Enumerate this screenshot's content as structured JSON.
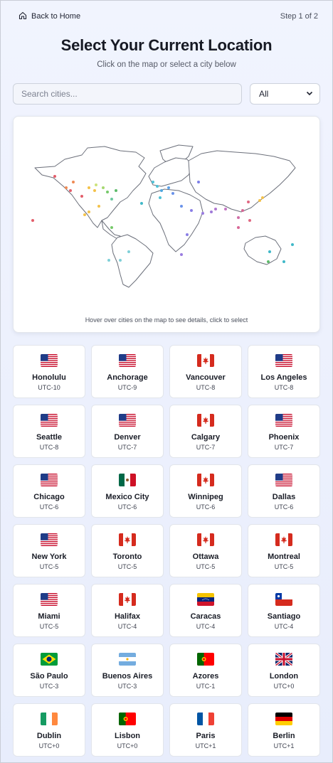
{
  "nav": {
    "back_label": "Back to Home",
    "step_label": "Step 1 of 2"
  },
  "header": {
    "title": "Select Your Current Location",
    "subtitle": "Click on the map or select a city below"
  },
  "search": {
    "placeholder": "Search cities...",
    "value": ""
  },
  "filter": {
    "selected": "All"
  },
  "map": {
    "hint": "Hover over cities on the map to see details, click to select"
  },
  "cities": [
    {
      "name": "Honolulu",
      "tz": "UTC-10",
      "flag": "us"
    },
    {
      "name": "Anchorage",
      "tz": "UTC-9",
      "flag": "us"
    },
    {
      "name": "Vancouver",
      "tz": "UTC-8",
      "flag": "ca"
    },
    {
      "name": "Los Angeles",
      "tz": "UTC-8",
      "flag": "us"
    },
    {
      "name": "Seattle",
      "tz": "UTC-8",
      "flag": "us"
    },
    {
      "name": "Denver",
      "tz": "UTC-7",
      "flag": "us"
    },
    {
      "name": "Calgary",
      "tz": "UTC-7",
      "flag": "ca"
    },
    {
      "name": "Phoenix",
      "tz": "UTC-7",
      "flag": "us"
    },
    {
      "name": "Chicago",
      "tz": "UTC-6",
      "flag": "us"
    },
    {
      "name": "Mexico City",
      "tz": "UTC-6",
      "flag": "mx"
    },
    {
      "name": "Winnipeg",
      "tz": "UTC-6",
      "flag": "ca"
    },
    {
      "name": "Dallas",
      "tz": "UTC-6",
      "flag": "us"
    },
    {
      "name": "New York",
      "tz": "UTC-5",
      "flag": "us"
    },
    {
      "name": "Toronto",
      "tz": "UTC-5",
      "flag": "ca"
    },
    {
      "name": "Ottawa",
      "tz": "UTC-5",
      "flag": "ca"
    },
    {
      "name": "Montreal",
      "tz": "UTC-5",
      "flag": "ca"
    },
    {
      "name": "Miami",
      "tz": "UTC-5",
      "flag": "us"
    },
    {
      "name": "Halifax",
      "tz": "UTC-4",
      "flag": "ca"
    },
    {
      "name": "Caracas",
      "tz": "UTC-4",
      "flag": "ve"
    },
    {
      "name": "Santiago",
      "tz": "UTC-4",
      "flag": "cl"
    },
    {
      "name": "São Paulo",
      "tz": "UTC-3",
      "flag": "br"
    },
    {
      "name": "Buenos Aires",
      "tz": "UTC-3",
      "flag": "ar"
    },
    {
      "name": "Azores",
      "tz": "UTC-1",
      "flag": "pt"
    },
    {
      "name": "London",
      "tz": "UTC+0",
      "flag": "gb"
    },
    {
      "name": "Dublin",
      "tz": "UTC+0",
      "flag": "ie"
    },
    {
      "name": "Lisbon",
      "tz": "UTC+0",
      "flag": "pt"
    },
    {
      "name": "Paris",
      "tz": "UTC+1",
      "flag": "fr"
    },
    {
      "name": "Berlin",
      "tz": "UTC+1",
      "flag": "de"
    }
  ]
}
